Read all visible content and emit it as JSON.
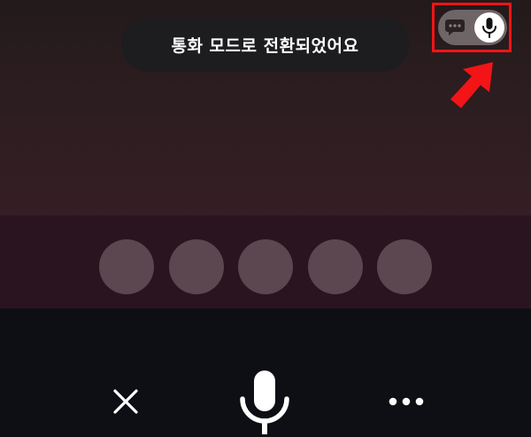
{
  "toast": {
    "message": "통화 모드로 전환되었어요"
  },
  "mode_toggle": {
    "options": [
      "chat-bubble-icon",
      "microphone-icon"
    ],
    "selected": "voice",
    "highlight_color": "#f21416"
  },
  "indicator": {
    "dot_count": 5
  },
  "controls": {
    "close_icon": "close-icon",
    "mic_icon": "microphone-icon",
    "more_icon": "more-horizontal-icon"
  },
  "colors": {
    "background_top": "#2c1d20",
    "background_mid": "#2a1420",
    "background_bottom": "#0d0f14",
    "dot": "#5c4650",
    "annotation": "#f21416"
  }
}
